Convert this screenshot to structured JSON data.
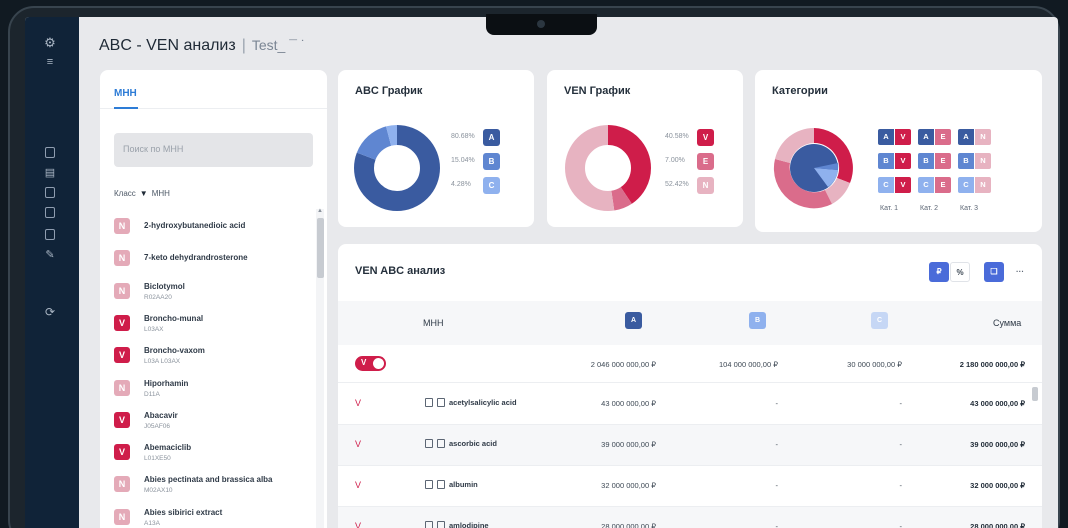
{
  "page": {
    "title": "ABC - VEN анализ",
    "separator": "|",
    "project": "Test_ ¯ ˙"
  },
  "left_panel": {
    "tab": "МНН",
    "search_placeholder": "Поиск по МНН",
    "filter_class": "Класс",
    "filter_mnn": "МНН",
    "items": [
      {
        "badge": "N",
        "name": "2-hydroxybutanedioic acid",
        "code": ""
      },
      {
        "badge": "N",
        "name": "7-keto dehydrandrosterone",
        "code": ""
      },
      {
        "badge": "N",
        "name": "Biclotymol",
        "code": "R02AA20"
      },
      {
        "badge": "V",
        "name": "Broncho-munal",
        "code": "L03AX"
      },
      {
        "badge": "V",
        "name": "Broncho-vaxom",
        "code": "L03A L03AX"
      },
      {
        "badge": "N",
        "name": "Hiporhamin",
        "code": "D11A"
      },
      {
        "badge": "V",
        "name": "Abacavir",
        "code": "J05AF06"
      },
      {
        "badge": "V",
        "name": "Abemaciclib",
        "code": "L01XE50"
      },
      {
        "badge": "N",
        "name": "Abies pectinata and brassica alba",
        "code": "M02AX10"
      },
      {
        "badge": "N",
        "name": "Abies sibirici extract",
        "code": "A13A"
      }
    ]
  },
  "abc_chart": {
    "title": "ABC График",
    "legend": [
      {
        "pct": "80.68%",
        "label": "A",
        "color": "#3a5ba0"
      },
      {
        "pct": "15.04%",
        "label": "B",
        "color": "#5f86d1"
      },
      {
        "pct": "4.28%",
        "label": "C",
        "color": "#8fb1ee"
      }
    ]
  },
  "ven_chart": {
    "title": "VEN График",
    "legend": [
      {
        "pct": "40.58%",
        "label": "V",
        "color": "#cf1d4a"
      },
      {
        "pct": "7.00%",
        "label": "E",
        "color": "#da6c8b"
      },
      {
        "pct": "52.42%",
        "label": "N",
        "color": "#e7b3c1"
      }
    ]
  },
  "categories": {
    "title": "Категории",
    "kat_labels": [
      "Кат. 1",
      "Кат. 2",
      "Кат. 3"
    ],
    "grid": [
      [
        {
          "a": "A",
          "b": "V"
        },
        {
          "a": "A",
          "b": "E"
        },
        {
          "a": "A",
          "b": "N"
        }
      ],
      [
        {
          "a": "B",
          "b": "V"
        },
        {
          "a": "B",
          "b": "E"
        },
        {
          "a": "B",
          "b": "N"
        }
      ],
      [
        {
          "a": "C",
          "b": "V"
        },
        {
          "a": "C",
          "b": "E"
        },
        {
          "a": "C",
          "b": "N"
        }
      ]
    ]
  },
  "table": {
    "title": "VEN ABC анализ",
    "btn_rub": "₽",
    "btn_pct": "%",
    "btn_more": "···",
    "col_mnn": "МНН",
    "col_a": "A",
    "col_b": "B",
    "col_c": "C",
    "col_sum": "Сумма",
    "toggle_label": "V",
    "totals": {
      "a": "2 046 000 000,00 ₽",
      "b": "104 000 000,00 ₽",
      "c": "30 000 000,00 ₽",
      "sum": "2 180 000 000,00 ₽"
    },
    "rows": [
      {
        "cls": "V",
        "name": "acetylsalicylic acid",
        "a": "43 000 000,00 ₽",
        "b": "-",
        "c": "-",
        "sum": "43 000 000,00 ₽"
      },
      {
        "cls": "V",
        "name": "ascorbic acid",
        "a": "39 000 000,00 ₽",
        "b": "-",
        "c": "-",
        "sum": "39 000 000,00 ₽"
      },
      {
        "cls": "V",
        "name": "albumin",
        "a": "32 000 000,00 ₽",
        "b": "-",
        "c": "-",
        "sum": "32 000 000,00 ₽"
      },
      {
        "cls": "V",
        "name": "amlodipine",
        "a": "28 000 000,00 ₽",
        "b": "-",
        "c": "-",
        "sum": "28 000 000,00 ₽"
      }
    ]
  },
  "colors": {
    "A": "#3a5ba0",
    "B": "#5f86d1",
    "C": "#8fb1ee",
    "V": "#cf1d4a",
    "E": "#da6c8b",
    "N": "#e7b3c1"
  }
}
